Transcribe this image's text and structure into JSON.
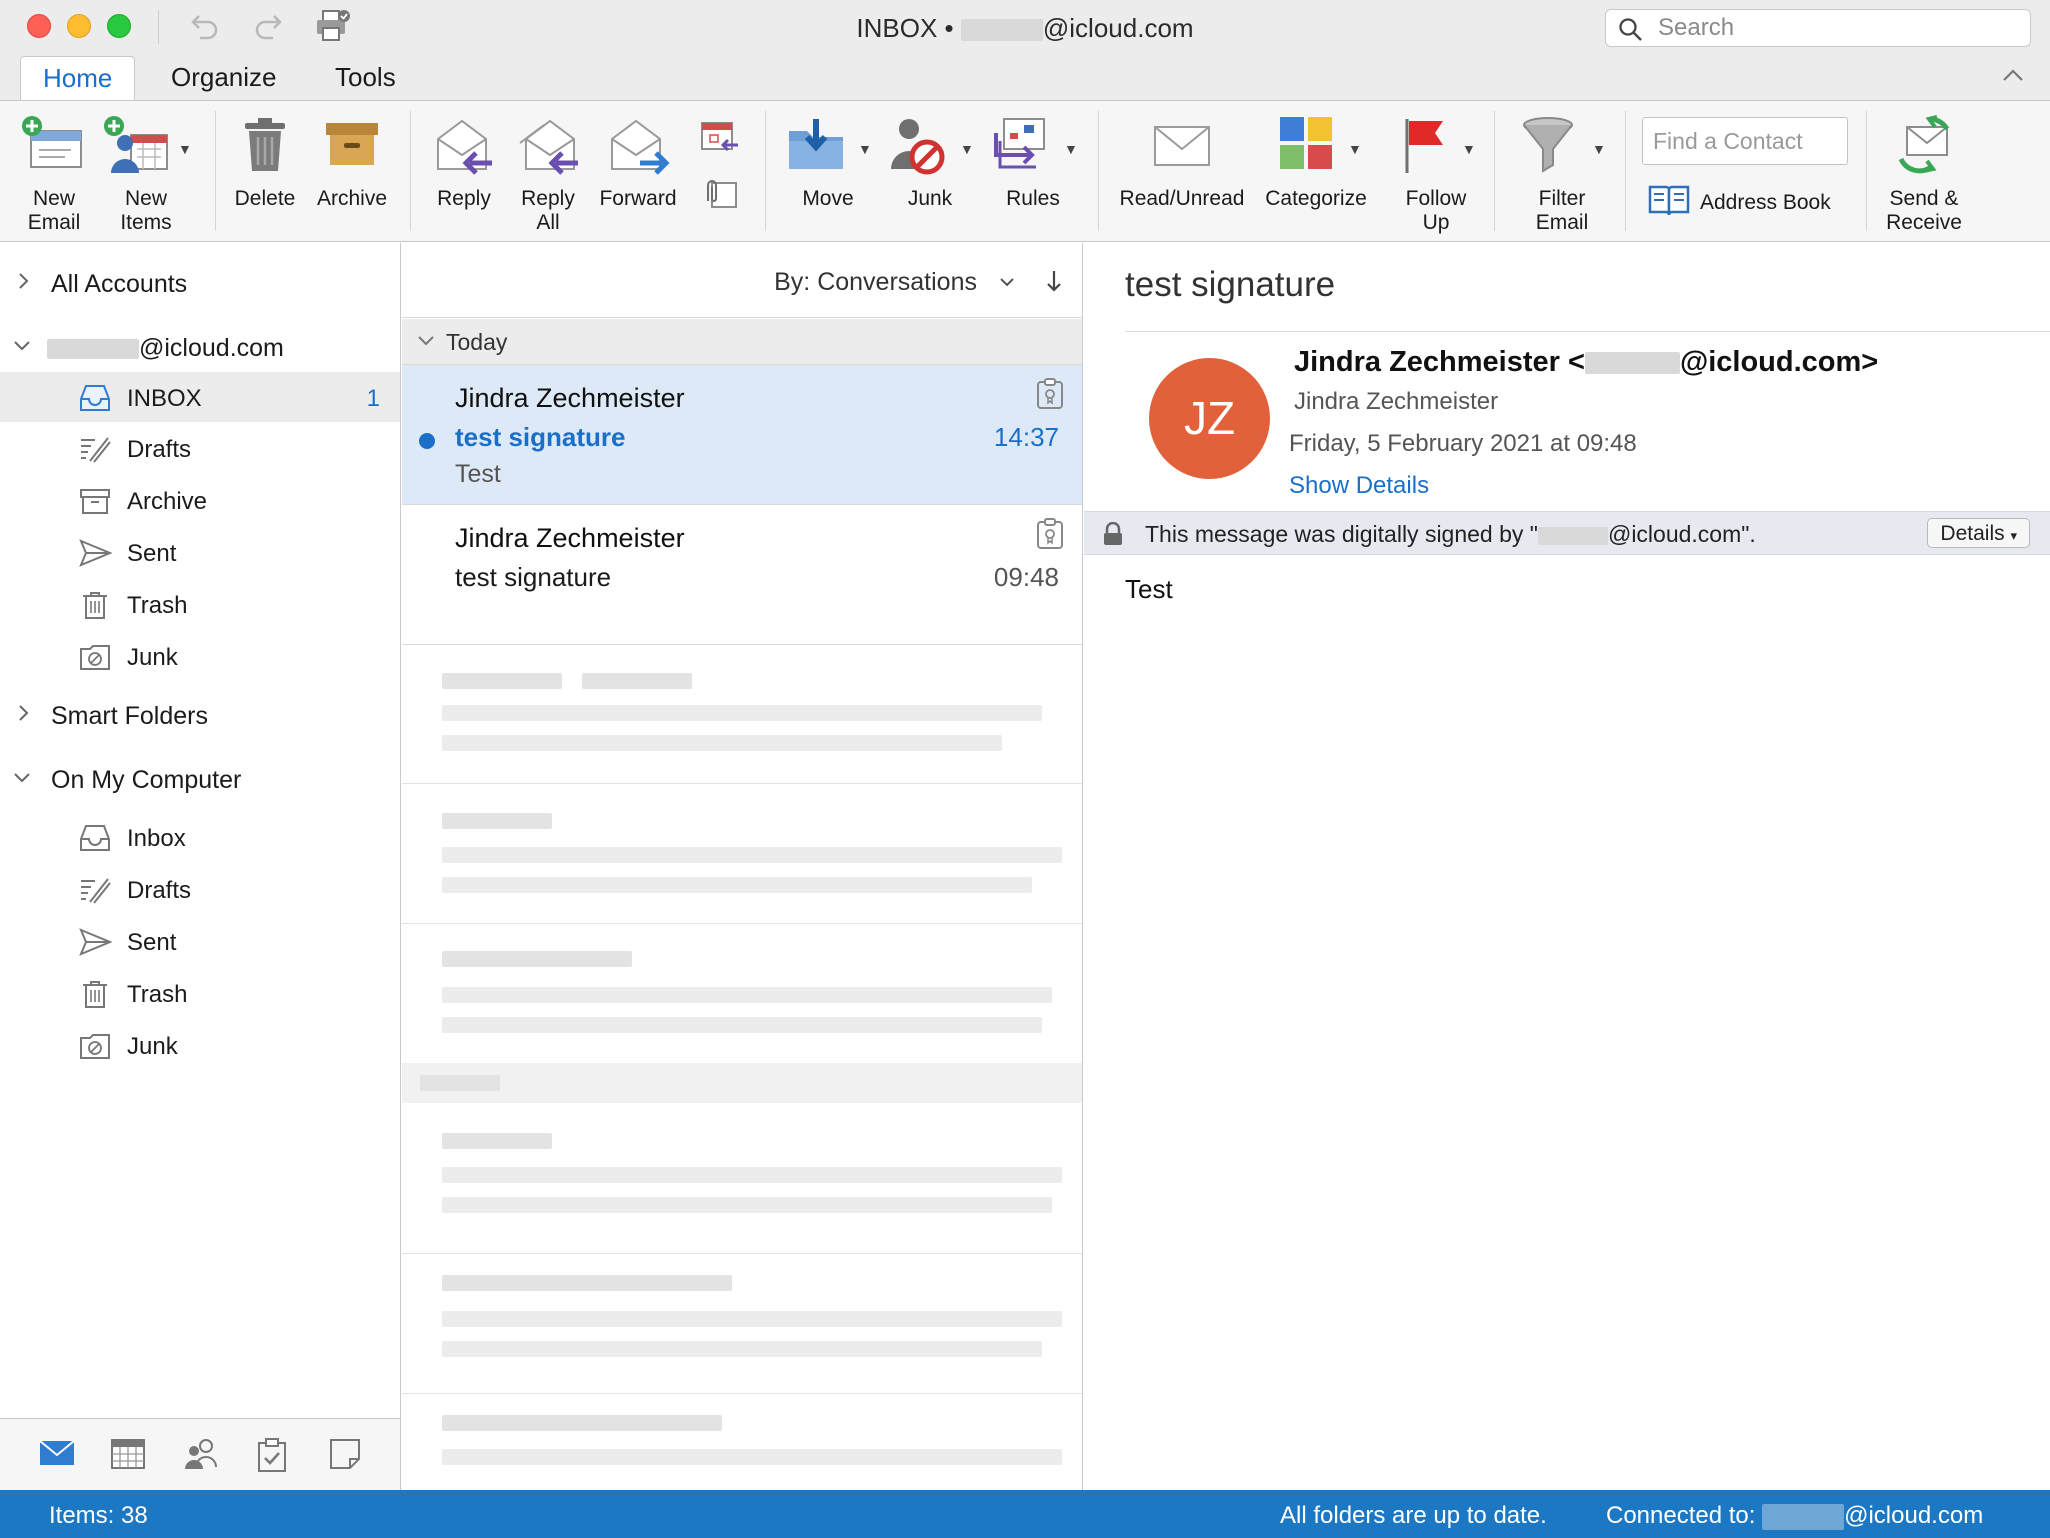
{
  "window": {
    "title_prefix": "INBOX •",
    "title_suffix": "@icloud.com",
    "search_placeholder": "Search"
  },
  "tabs": [
    {
      "label": "Home",
      "active": true
    },
    {
      "label": "Organize",
      "active": false
    },
    {
      "label": "Tools",
      "active": false
    }
  ],
  "ribbon": {
    "new_email": "New\nEmail",
    "new_items": "New\nItems",
    "delete": "Delete",
    "archive": "Archive",
    "reply": "Reply",
    "reply_all": "Reply\nAll",
    "forward": "Forward",
    "move": "Move",
    "junk": "Junk",
    "rules": "Rules",
    "read_unread": "Read/Unread",
    "categorize": "Categorize",
    "follow_up": "Follow\nUp",
    "filter_email": "Filter\nEmail",
    "find_contact_placeholder": "Find a Contact",
    "address_book": "Address Book",
    "send_receive": "Send &\nReceive"
  },
  "sidebar": {
    "all_accounts": "All Accounts",
    "account_suffix": "@icloud.com",
    "account_folders": [
      {
        "label": "INBOX",
        "icon": "inbox-icon",
        "count": "1",
        "selected": true
      },
      {
        "label": "Drafts",
        "icon": "drafts-icon"
      },
      {
        "label": "Archive",
        "icon": "archive-icon"
      },
      {
        "label": "Sent",
        "icon": "sent-icon"
      },
      {
        "label": "Trash",
        "icon": "trash-icon"
      },
      {
        "label": "Junk",
        "icon": "junk-icon"
      }
    ],
    "smart_folders": "Smart Folders",
    "on_my_computer": "On My Computer",
    "local_folders": [
      {
        "label": "Inbox",
        "icon": "inbox-icon"
      },
      {
        "label": "Drafts",
        "icon": "drafts-icon"
      },
      {
        "label": "Sent",
        "icon": "sent-icon"
      },
      {
        "label": "Trash",
        "icon": "trash-icon"
      },
      {
        "label": "Junk",
        "icon": "junk-icon"
      }
    ],
    "nav_icons": [
      "mail-icon",
      "calendar-icon",
      "people-icon",
      "tasks-icon",
      "notes-icon"
    ]
  },
  "message_list": {
    "sort_label": "By: Conversations",
    "group_label": "Today",
    "messages": [
      {
        "sender": "Jindra Zechmeister",
        "subject": "test signature",
        "preview": "Test",
        "time": "14:37",
        "unread": true,
        "selected": true
      },
      {
        "sender": "Jindra Zechmeister",
        "subject": "test signature",
        "preview": "",
        "time": "09:48",
        "unread": false,
        "selected": false
      }
    ]
  },
  "reading_pane": {
    "subject": "test signature",
    "avatar_initials": "JZ",
    "avatar_color": "#e2603a",
    "from_name": "Jindra Zechmeister",
    "from_prefix": "Jindra Zechmeister <",
    "from_suffix": "@icloud.com>",
    "date": "Friday, 5 February 2021 at 09:48",
    "show_details": "Show Details",
    "signature_prefix": "This message was digitally signed by \"",
    "signature_suffix": "@icloud.com\".",
    "details_button": "Details",
    "body": "Test"
  },
  "status_bar": {
    "items": "Items: 38",
    "sync": "All folders are up to date.",
    "connected_prefix": "Connected to:",
    "connected_suffix": "@icloud.com"
  },
  "colors": {
    "accent": "#1a6fc9",
    "status_bar": "#1d78c4",
    "selected_message": "#dde9f6"
  }
}
